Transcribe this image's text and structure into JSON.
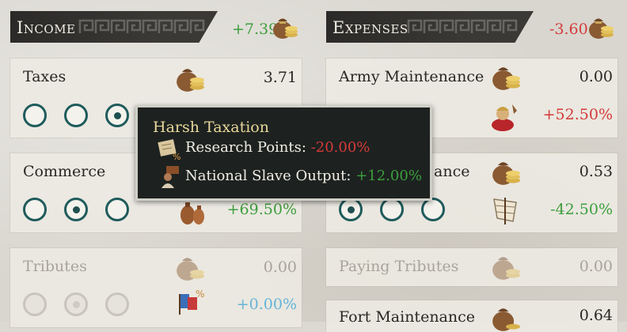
{
  "income": {
    "title": "Income",
    "total": "+7.39",
    "rows": {
      "taxes": {
        "label": "Taxes",
        "value": "3.71"
      },
      "commerce": {
        "label": "Commerce",
        "modifier": "+69.50%"
      },
      "tributes": {
        "label": "Tributes",
        "value": "0.00",
        "modifier": "+0.00%"
      }
    }
  },
  "expenses": {
    "title": "Expenses",
    "total": "-3.60",
    "rows": {
      "army": {
        "label": "Army Maintenance",
        "value": "0.00",
        "modifier": "+52.50%"
      },
      "navy": {
        "label_fragment": "ance",
        "value": "0.53",
        "modifier": "-42.50%"
      },
      "paying_tributes": {
        "label": "Paying Tributes",
        "value": "0.00"
      },
      "fort": {
        "label": "Fort Maintenance",
        "value": "0.64"
      }
    }
  },
  "tooltip": {
    "title": "Harsh Taxation",
    "lines": [
      {
        "label": "Research Points: ",
        "value": "-20.00%"
      },
      {
        "label": "National Slave Output: ",
        "value": "+12.00%"
      }
    ]
  },
  "colors": {
    "positive": "#3d9e3d",
    "negative": "#d43a3a",
    "neutral_blue": "#64b4d8",
    "radio_teal": "#1f5b5c",
    "tooltip_title": "#e9d79a"
  },
  "radio_state": {
    "taxes_selected": 3,
    "commerce_selected": 2,
    "tributes_selected": 2,
    "navy_selected": 1
  }
}
